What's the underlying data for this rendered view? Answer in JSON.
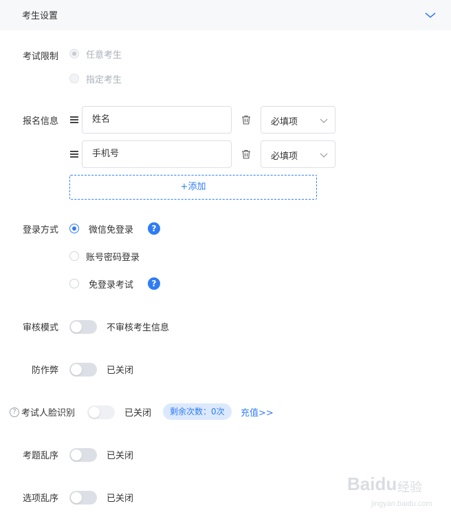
{
  "header": {
    "title": "考生设置",
    "collapse_icon": "chevron-down-icon"
  },
  "exam_limit": {
    "label": "考试限制",
    "options": [
      {
        "label": "任意考生",
        "checked": true,
        "disabled": true
      },
      {
        "label": "指定考生",
        "checked": false,
        "disabled": true
      }
    ]
  },
  "registration": {
    "label": "报名信息",
    "fields": [
      {
        "name": "姓名",
        "requirement": "必填项"
      },
      {
        "name": "手机号",
        "requirement": "必填项"
      }
    ],
    "add_label": "+添加"
  },
  "login": {
    "label": "登录方式",
    "options": [
      {
        "label": "微信免登录",
        "checked": true,
        "help": "?"
      },
      {
        "label": "账号密码登录",
        "checked": false
      },
      {
        "label": "免登录考试",
        "checked": false,
        "help": "?"
      }
    ]
  },
  "review": {
    "label": "审核模式",
    "state": "不审核考生信息",
    "on": false
  },
  "anti_cheat": {
    "label": "防作弊",
    "state": "已关闭",
    "on": false
  },
  "face_recognition": {
    "label": "考试人脸识别",
    "help": "?",
    "state": "已关闭",
    "on": false,
    "remaining": "剩余次数：0次",
    "recharge": "充值>>"
  },
  "question_shuffle": {
    "label": "考题乱序",
    "state": "已关闭",
    "on": false
  },
  "option_shuffle": {
    "label": "选项乱序",
    "state": "已关闭",
    "on": false
  },
  "watermark": {
    "brand": "Baidu",
    "cn": "经验",
    "url": "jingyan.baidu.com"
  },
  "colors": {
    "accent": "#2f7cf6",
    "header_bg": "#f7f8fa",
    "switch_off": "#dcdfe6"
  }
}
